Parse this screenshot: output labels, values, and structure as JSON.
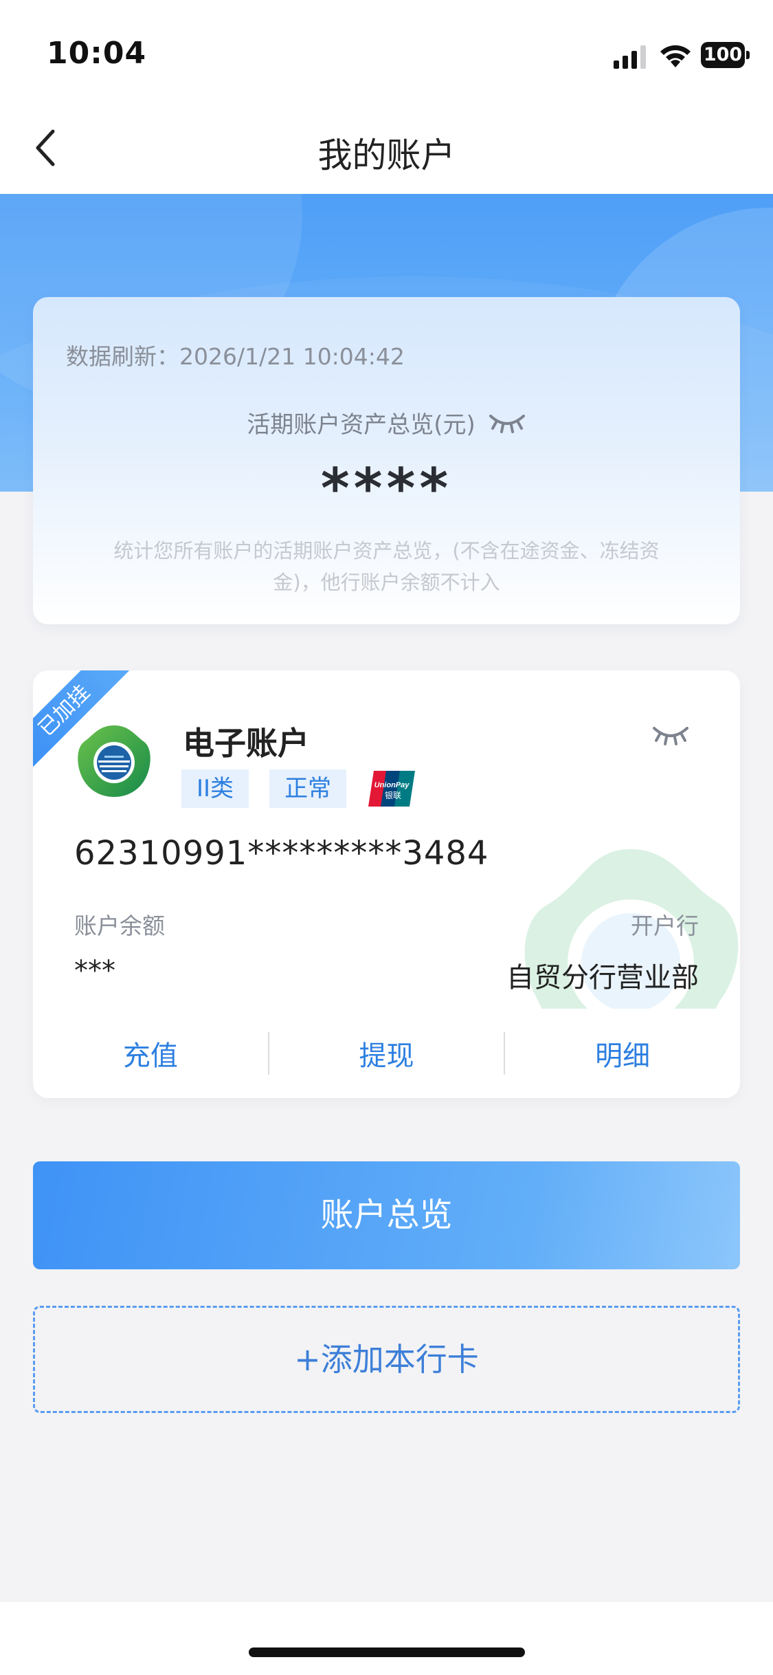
{
  "status_bar": {
    "time": "10:04",
    "battery": "100"
  },
  "nav": {
    "title": "我的账户"
  },
  "summary": {
    "refresh_prefix": "数据刷新：",
    "refresh_time": "2026/1/21 10:04:42",
    "total_label": "活期账户资产总览(元)",
    "total_amount": "****",
    "note": "统计您所有账户的活期账户资产总览，(不含在途资金、冻结资金)，他行账户余额不计入"
  },
  "account": {
    "ribbon": "已加挂",
    "name": "电子账户",
    "tags": [
      "II类",
      "正常"
    ],
    "card_number": "62310991*********3484",
    "balance_label": "账户余额",
    "balance_value": "***",
    "branch_label": "开户行",
    "branch_value": "自贸分行营业部",
    "actions": [
      "充值",
      "提现",
      "明细"
    ]
  },
  "buttons": {
    "overview": "账户总览",
    "add_card": "+添加本行卡"
  },
  "colors": {
    "accent": "#2d7fe0",
    "hero_blue": "#4f9ff7",
    "tag_bg": "#e6f1fd",
    "logo_green": "#2fa84f"
  },
  "icons": {
    "back": "chevron-left-icon",
    "eye_closed": "eye-closed-icon",
    "logo": "bank-logo-icon",
    "unionpay": "unionpay-icon"
  }
}
